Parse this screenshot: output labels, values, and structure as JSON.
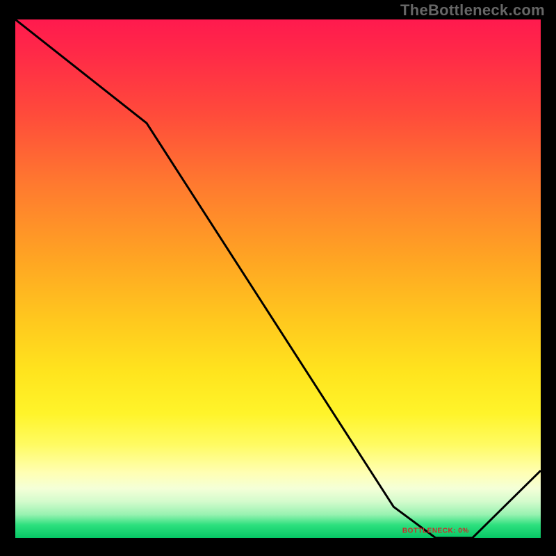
{
  "watermark": "TheBottleneck.com",
  "chart_data": {
    "type": "line",
    "title": "",
    "xlabel": "",
    "ylabel": "",
    "xlim": [
      0,
      100
    ],
    "ylim": [
      0,
      100
    ],
    "grid": false,
    "annotations": [
      {
        "text": "BOTTLENECK: 0%",
        "x": 80,
        "y": 1.4
      }
    ],
    "x": [
      0,
      25,
      72,
      80,
      87,
      100
    ],
    "values": [
      100,
      80,
      6,
      0,
      0,
      13
    ],
    "background_gradient_stops": [
      {
        "pos": 0,
        "color": "#ff1a4e"
      },
      {
        "pos": 6,
        "color": "#ff2848"
      },
      {
        "pos": 18,
        "color": "#ff4a3b"
      },
      {
        "pos": 32,
        "color": "#ff7a2f"
      },
      {
        "pos": 46,
        "color": "#ffa423"
      },
      {
        "pos": 58,
        "color": "#ffc81e"
      },
      {
        "pos": 68,
        "color": "#ffe41e"
      },
      {
        "pos": 76,
        "color": "#fff42a"
      },
      {
        "pos": 82,
        "color": "#fffb62"
      },
      {
        "pos": 87.5,
        "color": "#ffffb4"
      },
      {
        "pos": 90.5,
        "color": "#f4ffd8"
      },
      {
        "pos": 93,
        "color": "#d3fbcc"
      },
      {
        "pos": 95.5,
        "color": "#98f2b1"
      },
      {
        "pos": 97.5,
        "color": "#2de07e"
      },
      {
        "pos": 100,
        "color": "#06c765"
      }
    ],
    "line_color": "#000000",
    "line_width": 3
  }
}
